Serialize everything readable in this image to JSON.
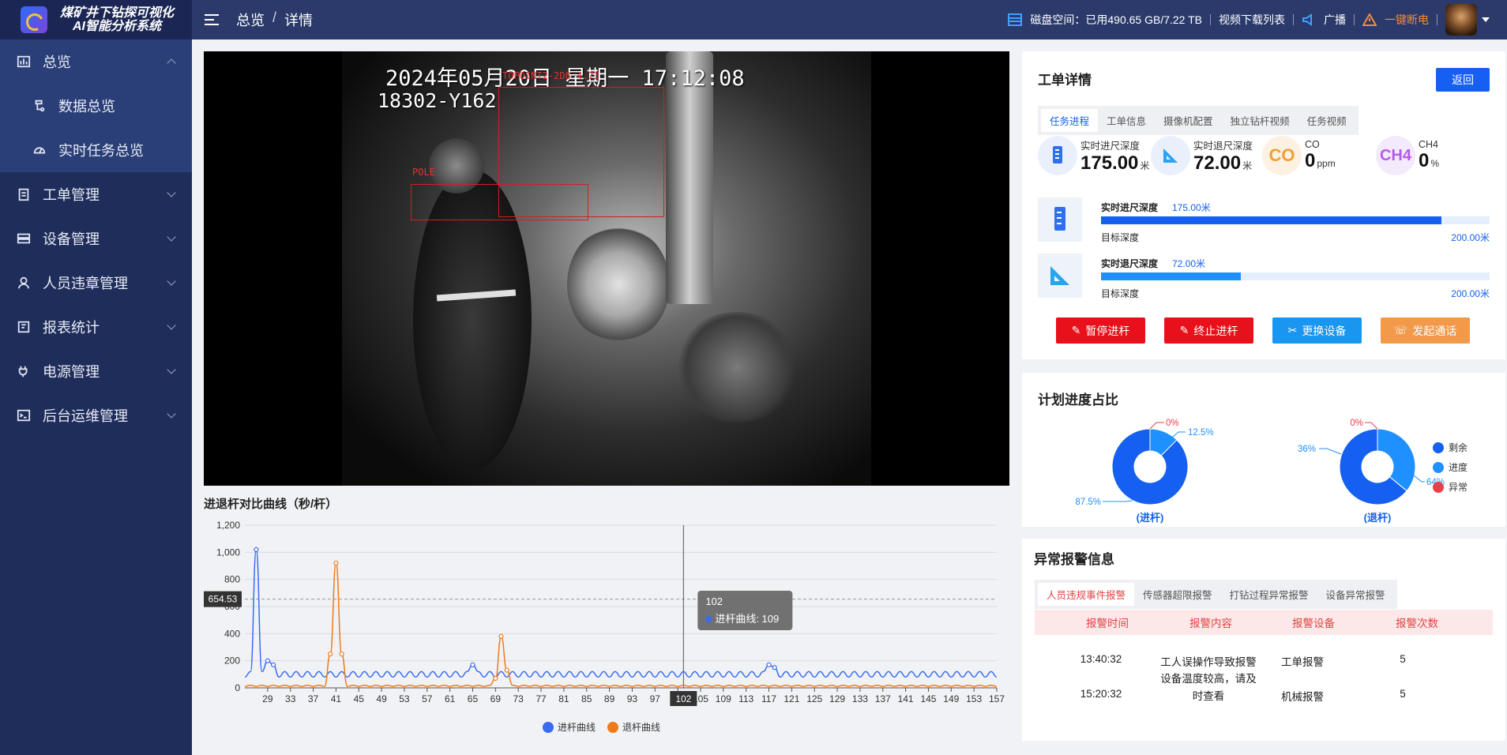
{
  "app": {
    "title_line1": "煤矿井下钻探可视化",
    "title_line2": "AI智能分析系统"
  },
  "sidebar": {
    "items": [
      {
        "label": "总览",
        "icon": "chart-icon"
      },
      {
        "label": "数据总览",
        "icon": "data-icon"
      },
      {
        "label": "实时任务总览",
        "icon": "dashboard-icon"
      },
      {
        "label": "工单管理",
        "icon": "clipboard-icon"
      },
      {
        "label": "设备管理",
        "icon": "device-icon"
      },
      {
        "label": "人员违章管理",
        "icon": "person-icon"
      },
      {
        "label": "报表统计",
        "icon": "report-icon"
      },
      {
        "label": "电源管理",
        "icon": "plug-icon"
      },
      {
        "label": "后台运维管理",
        "icon": "terminal-icon"
      }
    ]
  },
  "header": {
    "crumb1": "总览",
    "crumb_sep": "/",
    "crumb2": "详情",
    "disk_label": "磁盘空间：已用490.65 GB/7.22 TB",
    "video_download": "视频下载列表",
    "broadcast": "广播",
    "power_off": "一键断电"
  },
  "video": {
    "osd_line1": "2024年05月20日 星期一 17:12:08",
    "osd_line2": "18302-Y162",
    "box_label": "POLE",
    "box_label2": "TOPOINT2-2D8 4.73"
  },
  "chart_section": {
    "title": "进退杆对比曲线（秒/杆）"
  },
  "chart_data": {
    "type": "line",
    "x_first": 25,
    "x_last": 157,
    "x_tick_labels": [
      "29",
      "33",
      "37",
      "41",
      "45",
      "49",
      "53",
      "57",
      "61",
      "65",
      "69",
      "73",
      "77",
      "81",
      "85",
      "89",
      "93",
      "97",
      "101",
      "105",
      "109",
      "113",
      "117",
      "121",
      "125",
      "129",
      "133",
      "137",
      "141",
      "145",
      "149",
      "153",
      "157"
    ],
    "ylim": [
      0,
      1200
    ],
    "y_ticks": [
      "0",
      "200",
      "400",
      "600",
      "800",
      "1,000",
      "1,200"
    ],
    "mark_line_value": "654.53",
    "series": [
      {
        "name": "进杆曲线",
        "color": "#3a6cf0",
        "base": 100,
        "amplitude": 40,
        "period": 2,
        "peaks": [
          {
            "x": 27,
            "y": 1020
          },
          {
            "x": 29,
            "y": 200
          },
          {
            "x": 30,
            "y": 170
          },
          {
            "x": 65,
            "y": 170
          },
          {
            "x": 117,
            "y": 170
          },
          {
            "x": 118,
            "y": 150
          }
        ]
      },
      {
        "name": "退杆曲线",
        "color": "#f07a1a",
        "base": 15,
        "amplitude": 8,
        "period": 2,
        "peaks": [
          {
            "x": 40,
            "y": 250
          },
          {
            "x": 41,
            "y": 920
          },
          {
            "x": 42,
            "y": 250
          },
          {
            "x": 69,
            "y": 70
          },
          {
            "x": 70,
            "y": 380
          },
          {
            "x": 71,
            "y": 130
          }
        ]
      }
    ],
    "tooltip": {
      "x": "102",
      "series": "进杆曲线",
      "value": "109"
    },
    "axis_pointer_label": "102",
    "legend_placement": "bottom"
  },
  "order_detail": {
    "title": "工单详情",
    "back_button": "返回",
    "tabs": [
      "任务进程",
      "工单信息",
      "摄像机配置",
      "独立钻杆视频",
      "任务视频"
    ],
    "metrics": [
      {
        "label": "实时进尺深度",
        "value": "175.00",
        "unit": "米"
      },
      {
        "label": "实时退尺深度",
        "value": "72.00",
        "unit": "米"
      },
      {
        "label": "CO",
        "value": "0",
        "unit": "ppm"
      },
      {
        "label": "CH4",
        "value": "0",
        "unit": "%"
      }
    ],
    "progress": [
      {
        "label": "实时进尺深度",
        "value": "175.00米",
        "target_label": "目标深度",
        "target": "200.00米",
        "fraction": 0.875,
        "color": "#1560f0"
      },
      {
        "label": "实时退尺深度",
        "value": "72.00米",
        "target_label": "目标深度",
        "target": "200.00米",
        "fraction": 0.36,
        "color": "#1e90ff"
      }
    ],
    "actions": [
      {
        "label": "暂停进杆",
        "color": "#e8101a"
      },
      {
        "label": "终止进杆",
        "color": "#e8101a"
      },
      {
        "label": "更换设备",
        "color": "#1a96f0"
      },
      {
        "label": "发起通话",
        "color": "#f2994a"
      }
    ]
  },
  "plan_progress": {
    "title": "计划进度占比",
    "pie1": {
      "caption": "(进杆)",
      "remain": "87.5%",
      "progress": "12.5%",
      "abnormal": "0%",
      "fractions": [
        0.875,
        0.125,
        0.0
      ]
    },
    "pie2": {
      "caption": "(退杆)",
      "remain": "64%",
      "progress": "36%",
      "abnormal": "0%",
      "fractions": [
        0.64,
        0.36,
        0.0
      ]
    },
    "legend": [
      {
        "label": "剩余",
        "color": "#1560f0"
      },
      {
        "label": "进度",
        "color": "#1e90ff"
      },
      {
        "label": "异常",
        "color": "#e8404a"
      }
    ]
  },
  "alarms": {
    "title": "异常报警信息",
    "tabs": [
      "人员违规事件报警",
      "传感器超限报警",
      "打钻过程异常报警",
      "设备异常报警"
    ],
    "columns": [
      "报警时间",
      "报警内容",
      "报警设备",
      "报警次数"
    ],
    "rows": [
      {
        "time": "13:40:32",
        "content": "工人误操作导致报警",
        "device": "工单报警",
        "count": "5"
      },
      {
        "time": "15:20:32",
        "content": "设备温度较高，请及时查看",
        "device": "机械报警",
        "count": "5"
      }
    ]
  }
}
